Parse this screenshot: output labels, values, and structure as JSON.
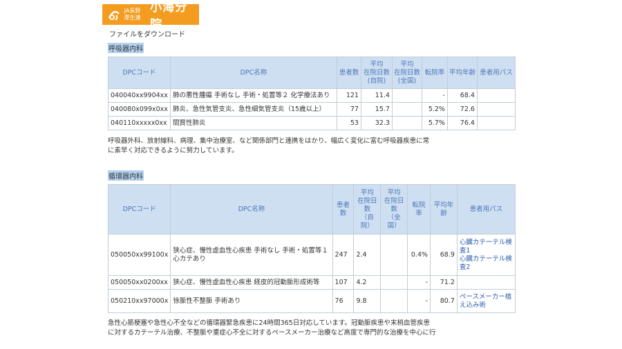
{
  "logo": {
    "line1": "JA長野",
    "line2": "厚生連",
    "name": "小海分院"
  },
  "download_link": "ファイルをダウンロード",
  "sections": [
    {
      "title": "呼吸器内科",
      "headers": [
        "DPCコード",
        "DPC名称",
        "患者数",
        "平均\n在院日数\n(自院)",
        "平均\n在院日数\n(全国)",
        "転院率",
        "平均年齢",
        "患者用パス"
      ],
      "rows": [
        {
          "code": "040040xx9904xx",
          "name": "肺の悪性腫瘍 手術なし 手術・処置等２ 化学療法あり",
          "patients": "121",
          "days_self": "11.4",
          "days_national": "",
          "transfer": "-",
          "age": "68.4",
          "path": ""
        },
        {
          "code": "040080x099x0xx",
          "name": "肺炎、急性気管支炎、急性細気管支炎（15歳以上）",
          "patients": "77",
          "days_self": "15.7",
          "days_national": "",
          "transfer": "5.2%",
          "age": "72.6",
          "path": ""
        },
        {
          "code": "040110xxxxx0xx",
          "name": "間質性肺炎",
          "patients": "53",
          "days_self": "32.3",
          "days_national": "",
          "transfer": "5.7%",
          "age": "76.4",
          "path": ""
        }
      ],
      "description": "呼吸器外科、放射線科、病理、集中治療室、など関係部門と連携をはかり、幅広く変化に富む呼吸器疾患に常\nに素早く対応できるように努力しています。"
    },
    {
      "title": "循環器内科",
      "headers": [
        "DPCコード",
        "DPC名称",
        "患者\n数",
        "平均\n在院日\n数\n（自\n院）",
        "平均\n在院日\n数\n（全\n国）",
        "転院\n率",
        "平均年\n齢",
        "患者用パス"
      ],
      "rows": [
        {
          "code": "050050xx99100x",
          "name": "狭心症、慢性虚血性心疾患 手術なし 手術・処置等１\n心カテあり",
          "patients": "247",
          "days_self": "2.4",
          "days_national": "",
          "transfer": "0.4%",
          "age": "68.9",
          "path": "心臓カテーテル検\n査1\n心臓カテーテル検\n査2"
        },
        {
          "code": "050050xx0200xx",
          "name": "狭心症、慢性虚血性心疾患 経皮的冠動脈形成術等",
          "patients": "107",
          "days_self": "4.2",
          "days_national": "",
          "transfer": "-",
          "age": "71.2",
          "path": ""
        },
        {
          "code": "050210xx97000x",
          "name": "徐脈性不整脈 手術あり",
          "patients": "76",
          "days_self": "9.8",
          "days_national": "",
          "transfer": "-",
          "age": "80.7",
          "path": "ペースメーカー植\nえ込み術"
        }
      ],
      "description": "急性心筋梗塞や急性心不全などの循環器緊急疾患に24時間365日対応しています。冠動脈疾患や末梢血管疾患\nに対するカテーテル治療、不整脈や重症心不全に対するペースメーカー治療など高度で専門的な治療を中心に行"
    }
  ]
}
